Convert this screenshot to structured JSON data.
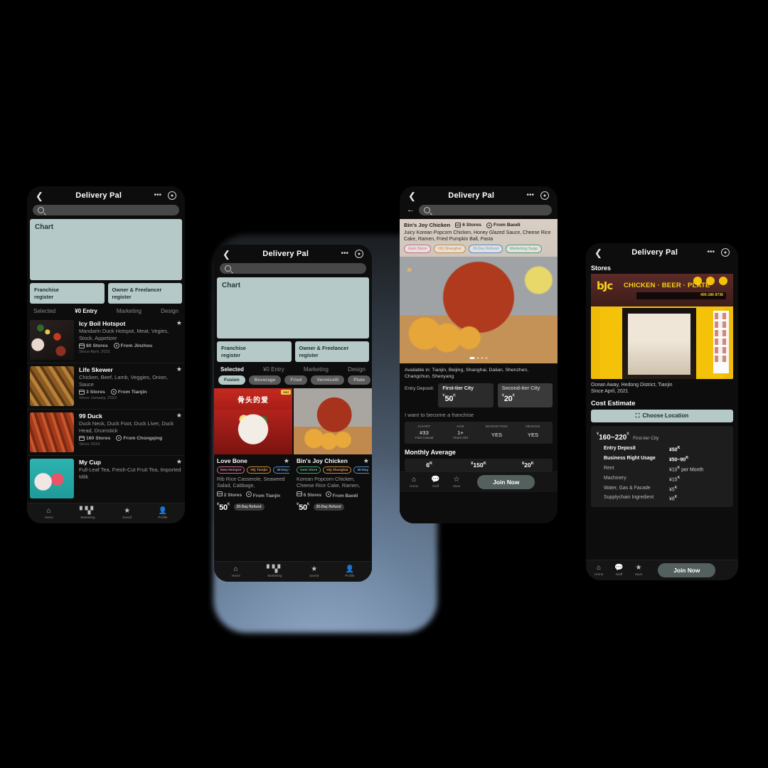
{
  "app": {
    "title": "Delivery Pal"
  },
  "icons": {
    "back": "back-chevron-icon",
    "more": "•••",
    "record": "record-ring-icon",
    "search": "search-icon",
    "star": "★",
    "home": "⌂",
    "chart": "▮▮▮",
    "profile": "person-icon"
  },
  "phone1": {
    "nav": {
      "title": "Delivery Pal"
    },
    "search": {
      "placeholder": ""
    },
    "chart_panel": {
      "label": "Chart"
    },
    "register_buttons": [
      {
        "line1": "Franchise",
        "line2": "register"
      },
      {
        "line1": "Owner & Freelancer",
        "line2": "register"
      }
    ],
    "tabs": [
      {
        "label": "Selected",
        "active": false
      },
      {
        "label": "¥0 Entry",
        "active": true
      },
      {
        "label": "Marketing",
        "active": false
      },
      {
        "label": "Design",
        "active": false
      }
    ],
    "items": [
      {
        "name": "Icy Boil Hotspot",
        "desc": "Mandarin Duck Hotspot, Meat, Vegies, Stock, Appetizer",
        "stores": "60 Stores",
        "from": "From Jinzhou",
        "since": "Since April, 2021",
        "art": "hotpot"
      },
      {
        "name": "Life Skewer",
        "desc": "Chicken, Beef, Lamb, Veggies, Onion, Sauce",
        "stores": "3 Stores",
        "from": "From Tianjin",
        "since": "Since January, 2022",
        "art": "skewer"
      },
      {
        "name": "99 Duck",
        "desc": "Duck Neck, Duck Foot, Duck Liver, Duck Head, Drumstick",
        "stores": "160 Stores",
        "from": "From Chongqing",
        "since": "Since 2016",
        "art": "duck"
      },
      {
        "name": "My Cup",
        "desc": "Full-Leaf Tea, Fresh-Cut Fruit Tea, Imported Milk",
        "stores": "",
        "from": "",
        "since": "",
        "art": "mycup"
      }
    ],
    "bottom_nav": [
      {
        "label": "Home",
        "icon": "home-icon"
      },
      {
        "label": "Marketing",
        "icon": "bar-chart-icon"
      },
      {
        "label": "Saved",
        "icon": "star-icon"
      },
      {
        "label": "Profile",
        "icon": "person-icon"
      }
    ]
  },
  "phone2": {
    "nav": {
      "title": "Delivery Pal"
    },
    "search": {
      "placeholder": ""
    },
    "chart_panel": {
      "label": "Chart"
    },
    "register_buttons": [
      {
        "line1": "Franchise",
        "line2": "register"
      },
      {
        "line1": "Owner & Freelancer",
        "line2": "register"
      }
    ],
    "tabs": [
      {
        "label": "Selected",
        "active": true
      },
      {
        "label": "¥0 Entry",
        "active": false
      },
      {
        "label": "Marketing",
        "active": false
      },
      {
        "label": "Design",
        "active": false
      }
    ],
    "chips": [
      {
        "label": "Fusion",
        "active": true
      },
      {
        "label": "Beverage",
        "active": false
      },
      {
        "label": "Fried",
        "active": false
      },
      {
        "label": "Vermicelli",
        "active": false
      },
      {
        "label": "Plate",
        "active": false
      }
    ],
    "cards": [
      {
        "name": "Love Bone",
        "badge": "Hot",
        "banner_cn": "骨头的爱",
        "art": "lovebone",
        "tags": [
          {
            "label": "New Hotspot",
            "color": "pink"
          },
          {
            "label": "HQ Tianjin",
            "color": "orange"
          },
          {
            "label": "30-Day R",
            "color": "blue"
          }
        ],
        "desc": "Rib Rice Casserole, Seaweed Salad, Cabbage,",
        "stores": "2 Stores",
        "from": "From Tianjin",
        "currency": "¥",
        "price": "50",
        "price_unit": "K",
        "pill": "30-Day Refund"
      },
      {
        "name": "Bin's Joy Chicken",
        "badge": "",
        "banner_cn": "",
        "art": "binschk",
        "tags": [
          {
            "label": "Gem Store",
            "color": "green"
          },
          {
            "label": "HQ Shanghai",
            "color": "orange"
          },
          {
            "label": "30-Day R",
            "color": "blue"
          }
        ],
        "desc": "Korean Popcorn Chicken, Cheese Rice Cake, Ramen,",
        "stores": "6 Stores",
        "from": "From Baodi",
        "currency": "¥",
        "price": "50",
        "price_unit": "K",
        "pill": "30-Day Refund"
      }
    ],
    "bottom_nav": [
      {
        "label": "Home",
        "icon": "home-icon"
      },
      {
        "label": "Marketing",
        "icon": "bar-chart-icon"
      },
      {
        "label": "Saved",
        "icon": "star-icon"
      },
      {
        "label": "Profile",
        "icon": "person-icon"
      }
    ]
  },
  "phone3": {
    "nav": {
      "title": "Delivery Pal"
    },
    "search": {
      "placeholder": ""
    },
    "brand": {
      "name": "Bin's Joy Chicken",
      "stores": "6 Stores",
      "from": "From Baodi",
      "desc": "Juicy Korean Popcorn Chicken, Honey Glazed Sauce, Cheese Rice Cake, Ramen, Fried Pumpkin Ball, Pasta",
      "chips": [
        {
          "label": "Gem Store",
          "color": "pink"
        },
        {
          "label": "HQ Shanghai",
          "color": "orange"
        },
        {
          "label": "30-Day Refund",
          "color": "blue"
        },
        {
          "label": "Marketing Supp",
          "color": "green"
        }
      ]
    },
    "carousel": {
      "total": 4,
      "active": 1
    },
    "available": "Available in: Tianjin, Beijing, Shanghai, Dalian, Shenzhen, Changchun, Shenyang",
    "entry_deposit": {
      "label": "Entry Deposit:",
      "options": [
        {
          "title": "First-tier City",
          "currency": "¥",
          "value": "50",
          "unit": "K",
          "selected": true
        },
        {
          "title": "Second-tier City",
          "currency": "¥",
          "value": "20",
          "unit": "K",
          "selected": false
        }
      ]
    },
    "cta_link": "I want to become a franchise",
    "stats": [
      {
        "key": "CHART",
        "value": "#33",
        "sub": "Fast Casual"
      },
      {
        "key": "AGE",
        "value": "1+",
        "sub": "Years Old"
      },
      {
        "key": "MARKETING",
        "value": "YES",
        "sub": ""
      },
      {
        "key": "DESIGN",
        "value": "YES",
        "sub": ""
      }
    ],
    "monthly": {
      "title": "Monthly Average",
      "cells": [
        {
          "currency": "",
          "value": "6",
          "unit": "K"
        },
        {
          "currency": "¥",
          "value": "150",
          "unit": "K"
        },
        {
          "currency": "¥",
          "value": "20",
          "unit": "K"
        }
      ]
    },
    "bottom_nav": [
      {
        "label": "Home",
        "icon": "home-icon"
      },
      {
        "label": "Staff",
        "icon": "chat-icon"
      },
      {
        "label": "Save",
        "icon": "star-outline-icon"
      }
    ],
    "join_button": "Join Now"
  },
  "phone4": {
    "nav": {
      "title": "Delivery Pal"
    },
    "section_title": "Stores",
    "store_photo": {
      "logo": "bJc",
      "sign": "CHICKEN · BEER · PLATE",
      "phone": "400-186 8736"
    },
    "address": "Ocean Away, Hedong District, Tianjin",
    "since": "Since April, 2021",
    "cost_title": "Cost Estimate",
    "choose_location": "Choose Location",
    "estimate": {
      "currency": "¥",
      "range": "160~220",
      "unit": "K",
      "tier": "First-tier City",
      "lines": [
        {
          "key": "Entry Deposit",
          "value": "¥50",
          "unit": "K",
          "suffix": "",
          "bold": true
        },
        {
          "key": "Business Right Usage",
          "value": "¥50~90",
          "unit": "K",
          "suffix": "",
          "bold": true
        },
        {
          "key": "Rent",
          "value": "¥10",
          "unit": "K",
          "suffix": " per Month",
          "bold": false
        },
        {
          "key": "Machinery",
          "value": "¥15",
          "unit": "K",
          "suffix": "",
          "bold": false
        },
        {
          "key": "Water, Gas & Facade",
          "value": "¥5",
          "unit": "K",
          "suffix": "",
          "bold": false
        },
        {
          "key": "Supplychain Ingredient",
          "value": "¥8",
          "unit": "K",
          "suffix": "",
          "bold": false
        }
      ]
    },
    "bottom_nav": [
      {
        "label": "Home",
        "icon": "home-icon"
      },
      {
        "label": "Staff",
        "icon": "chat-icon"
      },
      {
        "label": "Save",
        "icon": "star-icon"
      }
    ],
    "join_button": "Join Now"
  },
  "colors": {
    "background": "#000000",
    "phone_bg": "#0d0d0d",
    "accent_sage": "#b5c9c9",
    "join_button": "#53605e",
    "brand_yellow": "#f5c20a"
  }
}
